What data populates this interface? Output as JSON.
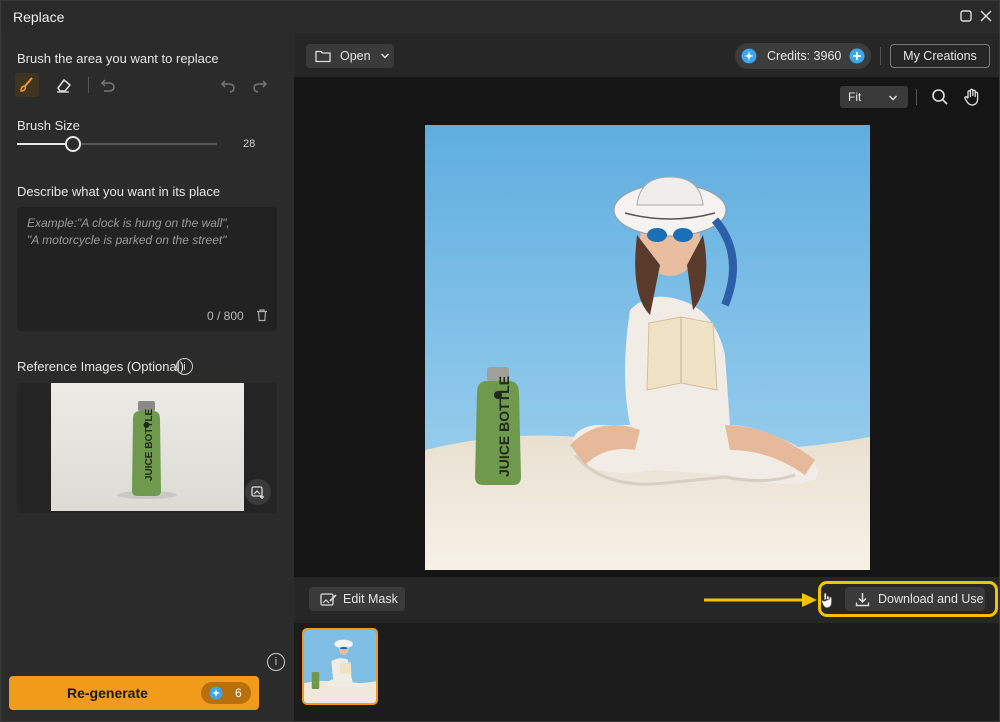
{
  "window": {
    "title": "Replace"
  },
  "brush": {
    "label": "Brush the area you want to replace",
    "size_label": "Brush Size",
    "size_value": "28",
    "size_fraction": 0.28
  },
  "prompt": {
    "label": "Describe what you want in its place",
    "placeholder": "Example:\"A clock is hung on the wall\",\n\"A motorcycle is parked on the street\"",
    "count": "0 / 800"
  },
  "reference": {
    "label": "Reference Images (Optional)",
    "bottle_text": "JUICE BOTTLE"
  },
  "regenerate": {
    "label": "Re-generate",
    "cost": "6"
  },
  "topbar": {
    "open_label": "Open",
    "credits_label": "Credits: 3960",
    "my_creations_label": "My Creations"
  },
  "canvas": {
    "zoom": "Fit",
    "bottle_text": "JUICE BOTTLE"
  },
  "bottombar": {
    "edit_mask_label": "Edit Mask",
    "download_label": "Download and Use"
  },
  "colors": {
    "accent": "#f29a1a",
    "highlight": "#f5c400",
    "credit_icon": "#3aa8f0"
  }
}
